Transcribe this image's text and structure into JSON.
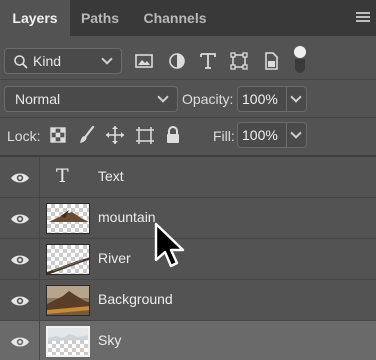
{
  "tabs": [
    {
      "label": "Layers",
      "active": true
    },
    {
      "label": "Paths",
      "active": false
    },
    {
      "label": "Channels",
      "active": false
    }
  ],
  "filter": {
    "kind_label": "Kind",
    "filter_icons": [
      "image-filter-icon",
      "adjustment-filter-icon",
      "type-filter-icon",
      "shape-filter-icon",
      "smart-object-filter-icon"
    ],
    "toggle_icon": "filter-toggle-icon"
  },
  "blend": {
    "mode": "Normal",
    "opacity_label": "Opacity:",
    "opacity_value": "100%"
  },
  "lock": {
    "label": "Lock:",
    "icons": [
      "lock-transparent-pixels-icon",
      "lock-image-pixels-icon",
      "lock-position-icon",
      "lock-artboard-icon",
      "lock-all-icon"
    ],
    "fill_label": "Fill:",
    "fill_value": "100%"
  },
  "layers": [
    {
      "name": "Text",
      "kind": "type",
      "visible": true,
      "selected": false
    },
    {
      "name": "mountain",
      "kind": "image",
      "visible": true,
      "selected": false
    },
    {
      "name": "River",
      "kind": "image",
      "visible": true,
      "selected": false
    },
    {
      "name": "Background",
      "kind": "image",
      "visible": true,
      "selected": false
    },
    {
      "name": "Sky",
      "kind": "image",
      "visible": true,
      "selected": true
    }
  ],
  "type_glyph": "T",
  "colors": {
    "panel": "#535353",
    "tabbar": "#393939",
    "selected_row": "#6a6a6a",
    "text": "#e6e6e6"
  }
}
